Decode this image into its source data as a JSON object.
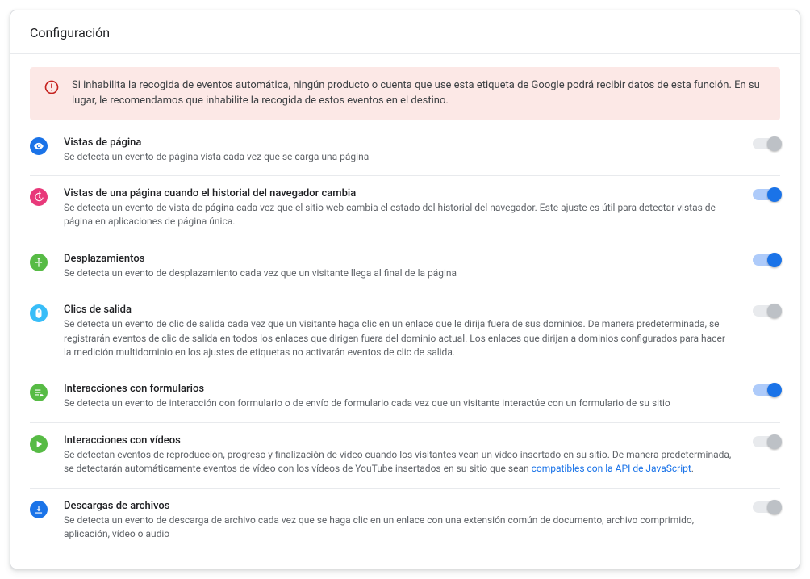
{
  "header": {
    "title": "Configuración"
  },
  "alert": {
    "text": "Si inhabilita la recogida de eventos automática, ningún producto o cuenta que use esta etiqueta de Google podrá recibir datos de esta función. En su lugar, le recomendamos que inhabilite la recogida de estos eventos en el destino."
  },
  "settings": [
    {
      "id": "page-views",
      "icon": "eye",
      "icon_bg": "#1a73e8",
      "title": "Vistas de página",
      "desc": "Se detecta un evento de página vista cada vez que se carga una página",
      "enabled": false
    },
    {
      "id": "history-change-views",
      "icon": "history",
      "icon_bg": "#e8397a",
      "title": "Vistas de una página cuando el historial del navegador cambia",
      "desc": "Se detecta un evento de vista de página cada vez que el sitio web cambia el estado del historial del navegador. Este ajuste es útil para detectar vistas de página en aplicaciones de página única.",
      "enabled": true
    },
    {
      "id": "scrolls",
      "icon": "scroll",
      "icon_bg": "#57bb45",
      "title": "Desplazamientos",
      "desc": "Se detecta un evento de desplazamiento cada vez que un visitante llega al final de la página",
      "enabled": true
    },
    {
      "id": "outbound-clicks",
      "icon": "mouse",
      "icon_bg": "#38bdf8",
      "title": "Clics de salida",
      "desc": "Se detecta un evento de clic de salida cada vez que un visitante haga clic en un enlace que le dirija fuera de sus dominios. De manera predeterminada, se registrarán eventos de clic de salida en todos los enlaces que dirigen fuera del dominio actual. Los enlaces que dirijan a dominios configurados para hacer la medición multidominio en los ajustes de etiquetas no activarán eventos de clic de salida.",
      "enabled": false
    },
    {
      "id": "form-interactions",
      "icon": "form",
      "icon_bg": "#57bb45",
      "title": "Interacciones con formularios",
      "desc": "Se detecta un evento de interacción con formulario o de envío de formulario cada vez que un visitante interactúe con un formulario de su sitio",
      "enabled": true
    },
    {
      "id": "video-engagement",
      "icon": "play",
      "icon_bg": "#57bb45",
      "title": "Interacciones con vídeos",
      "desc_before_link": "Se detectan eventos de reproducción, progreso y finalización de vídeo cuando los visitantes vean un vídeo insertado en su sitio. De manera predeterminada, se detectarán automáticamente eventos de vídeo con los vídeos de YouTube insertados en su sitio que sean ",
      "link_text": "compatibles con la API de JavaScript",
      "desc_after_link": ".",
      "enabled": false
    },
    {
      "id": "file-downloads",
      "icon": "download",
      "icon_bg": "#1a73e8",
      "title": "Descargas de archivos",
      "desc": "Se detecta un evento de descarga de archivo cada vez que se haga clic en un enlace con una extensión común de documento, archivo comprimido, aplicación, vídeo o audio",
      "enabled": false
    }
  ]
}
